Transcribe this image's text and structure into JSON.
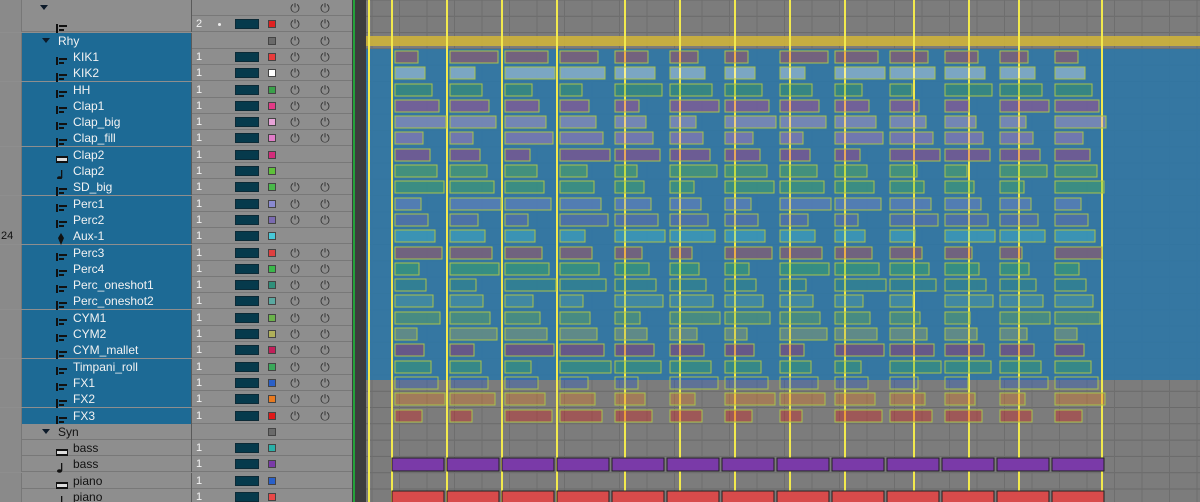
{
  "app": {
    "name": "DAW track list and arrangement"
  },
  "colors": {
    "selection": "#1d6a95",
    "track_bg": "#8e8e8e",
    "arrange_bg": "#7c7c7c",
    "clip_overlay": "#2e77a6",
    "locator": "#f2e94d",
    "playhead": "#23a23a",
    "rhy_bar": "#d3b637",
    "bass_clips": "#7a3aa8",
    "piano_clips": "#d84b4b"
  },
  "side_number": "24",
  "tracks": [
    {
      "name": "",
      "type": "top",
      "num": "",
      "color": "",
      "selected": false
    },
    {
      "name": "",
      "type": "midi",
      "num": "2",
      "color": "#e02020",
      "selected": false,
      "dot": true,
      "power": 2
    },
    {
      "name": "Rhy",
      "type": "folder",
      "num": "",
      "color": "#6a6a6a",
      "selected": true,
      "power": 2
    },
    {
      "name": "KIK1",
      "type": "midi",
      "num": "1",
      "color": "#e83b3b",
      "selected": true,
      "power": 2
    },
    {
      "name": "KIK2",
      "type": "midi",
      "num": "1",
      "color": "#ffffff",
      "selected": true,
      "power": 2
    },
    {
      "name": "HH",
      "type": "midi",
      "num": "1",
      "color": "#3aa04a",
      "selected": true,
      "power": 2
    },
    {
      "name": "Clap1",
      "type": "midi",
      "num": "1",
      "color": "#e23a86",
      "selected": true,
      "power": 2
    },
    {
      "name": "Clap_big",
      "type": "midi",
      "num": "1",
      "color": "#e7a3d8",
      "selected": true,
      "power": 2
    },
    {
      "name": "Clap_fill",
      "type": "midi",
      "num": "1",
      "color": "#e07cc8",
      "selected": true,
      "power": 2
    },
    {
      "name": "Clap2",
      "type": "audio",
      "num": "1",
      "color": "#d42c7b",
      "selected": true,
      "power": 0
    },
    {
      "name": "Clap2",
      "type": "note",
      "num": "1",
      "color": "#5ec13a",
      "selected": true,
      "power": 0
    },
    {
      "name": "SD_big",
      "type": "midi",
      "num": "1",
      "color": "#49b84a",
      "selected": true,
      "power": 2
    },
    {
      "name": "Perc1",
      "type": "midi",
      "num": "1",
      "color": "#8a8ad0",
      "selected": true,
      "power": 2
    },
    {
      "name": "Perc2",
      "type": "midi",
      "num": "1",
      "color": "#7a6ab0",
      "selected": true,
      "power": 2
    },
    {
      "name": "Aux-1",
      "type": "aux",
      "num": "1",
      "color": "#48c8d8",
      "selected": true,
      "power": 0
    },
    {
      "name": "Perc3",
      "type": "midi",
      "num": "1",
      "color": "#e04040",
      "selected": true,
      "power": 2
    },
    {
      "name": "Perc4",
      "type": "midi",
      "num": "1",
      "color": "#3ab84a",
      "selected": true,
      "power": 2
    },
    {
      "name": "Perc_oneshot1",
      "type": "midi",
      "num": "1",
      "color": "#2f8f7a",
      "selected": true,
      "power": 2
    },
    {
      "name": "Perc_oneshot2",
      "type": "midi",
      "num": "1",
      "color": "#5aa8a0",
      "selected": true,
      "power": 2
    },
    {
      "name": "CYM1",
      "type": "midi",
      "num": "1",
      "color": "#6ab24a",
      "selected": true,
      "power": 2
    },
    {
      "name": "CYM2",
      "type": "midi",
      "num": "1",
      "color": "#b0b05a",
      "selected": true,
      "power": 2
    },
    {
      "name": "CYM_mallet",
      "type": "midi",
      "num": "1",
      "color": "#c2205a",
      "selected": true,
      "power": 2
    },
    {
      "name": "Timpani_roll",
      "type": "midi",
      "num": "1",
      "color": "#3aa85a",
      "selected": true,
      "power": 2
    },
    {
      "name": "FX1",
      "type": "midi",
      "num": "1",
      "color": "#2a60c8",
      "selected": true,
      "power": 2
    },
    {
      "name": "FX2",
      "type": "midi",
      "num": "1",
      "color": "#e87a20",
      "selected": true,
      "power": 2
    },
    {
      "name": "FX3",
      "type": "midi",
      "num": "1",
      "color": "#e01818",
      "selected": true,
      "power": 2
    },
    {
      "name": "Syn",
      "type": "folder",
      "num": "",
      "color": "#6a6a6a",
      "selected": false,
      "power": 0
    },
    {
      "name": "bass",
      "type": "audio",
      "num": "1",
      "color": "#2ab0a8",
      "selected": false,
      "power": 0
    },
    {
      "name": "bass",
      "type": "note",
      "num": "1",
      "color": "#7a3aa8",
      "selected": false,
      "power": 0
    },
    {
      "name": "piano",
      "type": "audio",
      "num": "1",
      "color": "#2a60c8",
      "selected": false,
      "power": 0
    },
    {
      "name": "piano",
      "type": "note",
      "num": "1",
      "color": "#e84848",
      "selected": false,
      "power": 0
    }
  ],
  "icons": {
    "power": "power-icon",
    "disclosure": "disclosure-triangle-icon"
  }
}
